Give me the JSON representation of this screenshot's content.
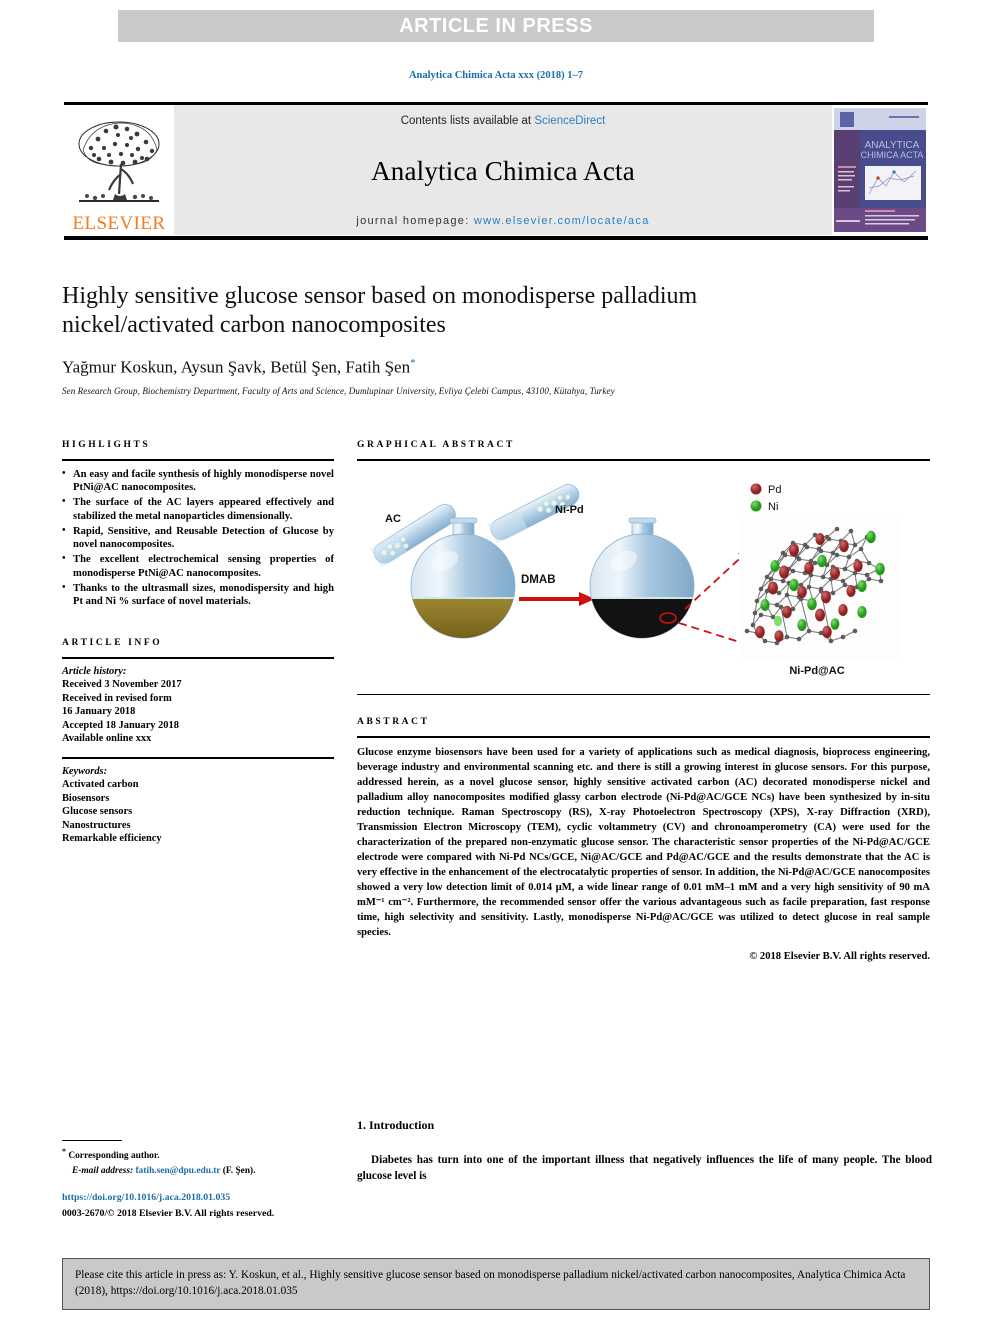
{
  "banner": {
    "text": "ARTICLE IN PRESS"
  },
  "running_head": "Analytica Chimica Acta xxx (2018) 1–7",
  "masthead": {
    "contents_prefix": "Contents lists available at ",
    "contents_link": "ScienceDirect",
    "journal_name": "Analytica Chimica Acta",
    "homepage_prefix": "journal homepage: ",
    "homepage_url": "www.elsevier.com/locate/aca",
    "publisher": "ELSEVIER",
    "cover_title_line1": "ANALYTICA",
    "cover_title_line2": "CHIMICA ACTA"
  },
  "article": {
    "title": "Highly sensitive glucose sensor based on monodisperse palladium nickel/activated carbon nanocomposites",
    "authors": "Yağmur Koskun, Aysun Şavk, Betül Şen, Fatih Şen",
    "corresponding_marker": "*",
    "affiliation": "Sen Research Group, Biochemistry Department, Faculty of Arts and Science, Dumlupinar University, Evliya Çelebi Campus, 43100, Kütahya, Turkey"
  },
  "highlights": {
    "heading": "HIGHLIGHTS",
    "items": [
      "An easy and facile synthesis of highly monodisperse novel PtNi@AC nanocomposites.",
      "The surface of the AC layers appeared effectively and stabilized the metal nanoparticles dimensionally.",
      "Rapid, Sensitive, and Reusable Detection of Glucose by novel nanocomposites.",
      "The excellent electrochemical sensing properties of monodisperse PtNi@AC nanocomposites.",
      "Thanks to the ultrasmall sizes, monodispersity and high Pt and Ni % surface of novel materials."
    ]
  },
  "article_info": {
    "heading": "ARTICLE INFO",
    "history_label": "Article history:",
    "history": [
      "Received 3 November 2017",
      "Received in revised form",
      "16 January 2018",
      "Accepted 18 January 2018",
      "Available online xxx"
    ],
    "keywords_label": "Keywords:",
    "keywords": [
      "Activated carbon",
      "Biosensors",
      "Glucose sensors",
      "Nanostructures",
      "Remarkable efficiency"
    ]
  },
  "graphical_abstract": {
    "heading": "GRAPHICAL ABSTRACT",
    "labels": {
      "ac": "AC",
      "nipd": "Ni-Pd",
      "reagent": "DMAB",
      "legend_pd": "Pd",
      "legend_ni": "Ni",
      "product": "Ni-Pd@AC"
    },
    "colors": {
      "pd": "#9e2a2a",
      "ni": "#33a02c",
      "arrow": "#cc1111",
      "flask_glass": "#a9c8e0",
      "solution_before": "#8a7525",
      "solution_after": "#121212"
    }
  },
  "abstract": {
    "heading": "ABSTRACT",
    "body": "Glucose enzyme biosensors have been used for a variety of applications such as medical diagnosis, bioprocess engineering, beverage industry and environmental scanning etc. and there is still a growing interest in glucose sensors. For this purpose, addressed herein, as a novel glucose sensor, highly sensitive activated carbon (AC) decorated monodisperse nickel and palladium alloy nanocomposites modified glassy carbon electrode (Ni-Pd@AC/GCE NCs) have been synthesized by in-situ reduction technique. Raman Spectroscopy (RS), X-ray Photoelectron Spectroscopy (XPS), X-ray Diffraction (XRD), Transmission Electron Microscopy (TEM), cyclic voltammetry (CV) and chronoamperometry (CA) were used for the characterization of the prepared non-enzymatic glucose sensor. The characteristic sensor properties of the Ni-Pd@AC/GCE electrode were compared with Ni-Pd NCs/GCE, Ni@AC/GCE and Pd@AC/GCE and the results demonstrate that the AC is very effective in the enhancement of the electrocatalytic properties of sensor. In addition, the Ni-Pd@AC/GCE nanocomposites showed a very low detection limit of 0.014 µM, a wide linear range of 0.01 mM–1 mM and a very high sensitivity of 90 mA mM⁻¹ cm⁻². Furthermore, the recommended sensor offer the various advantageous such as facile preparation, fast response time, high selectivity and sensitivity. Lastly, monodisperse Ni-Pd@AC/GCE was utilized to detect glucose in real sample species.",
    "copyright": "© 2018 Elsevier B.V. All rights reserved."
  },
  "introduction": {
    "heading": "1. Introduction",
    "body": "Diabetes has turn into one of the important illness that negatively influences the life of many people. The blood glucose level is"
  },
  "footnote": {
    "marker": "*",
    "corresponding": "Corresponding author.",
    "email_label": "E-mail address:",
    "email": "fatih.sen@dpu.edu.tr",
    "email_suffix": "(F. Şen).",
    "doi": "https://doi.org/10.1016/j.aca.2018.01.035",
    "issn_line": "0003-2670/© 2018 Elsevier B.V. All rights reserved."
  },
  "citation_box": {
    "text": "Please cite this article in press as: Y. Koskun, et al., Highly sensitive glucose sensor based on monodisperse palladium nickel/activated carbon nanocomposites, Analytica Chimica Acta (2018), https://doi.org/10.1016/j.aca.2018.01.035"
  }
}
